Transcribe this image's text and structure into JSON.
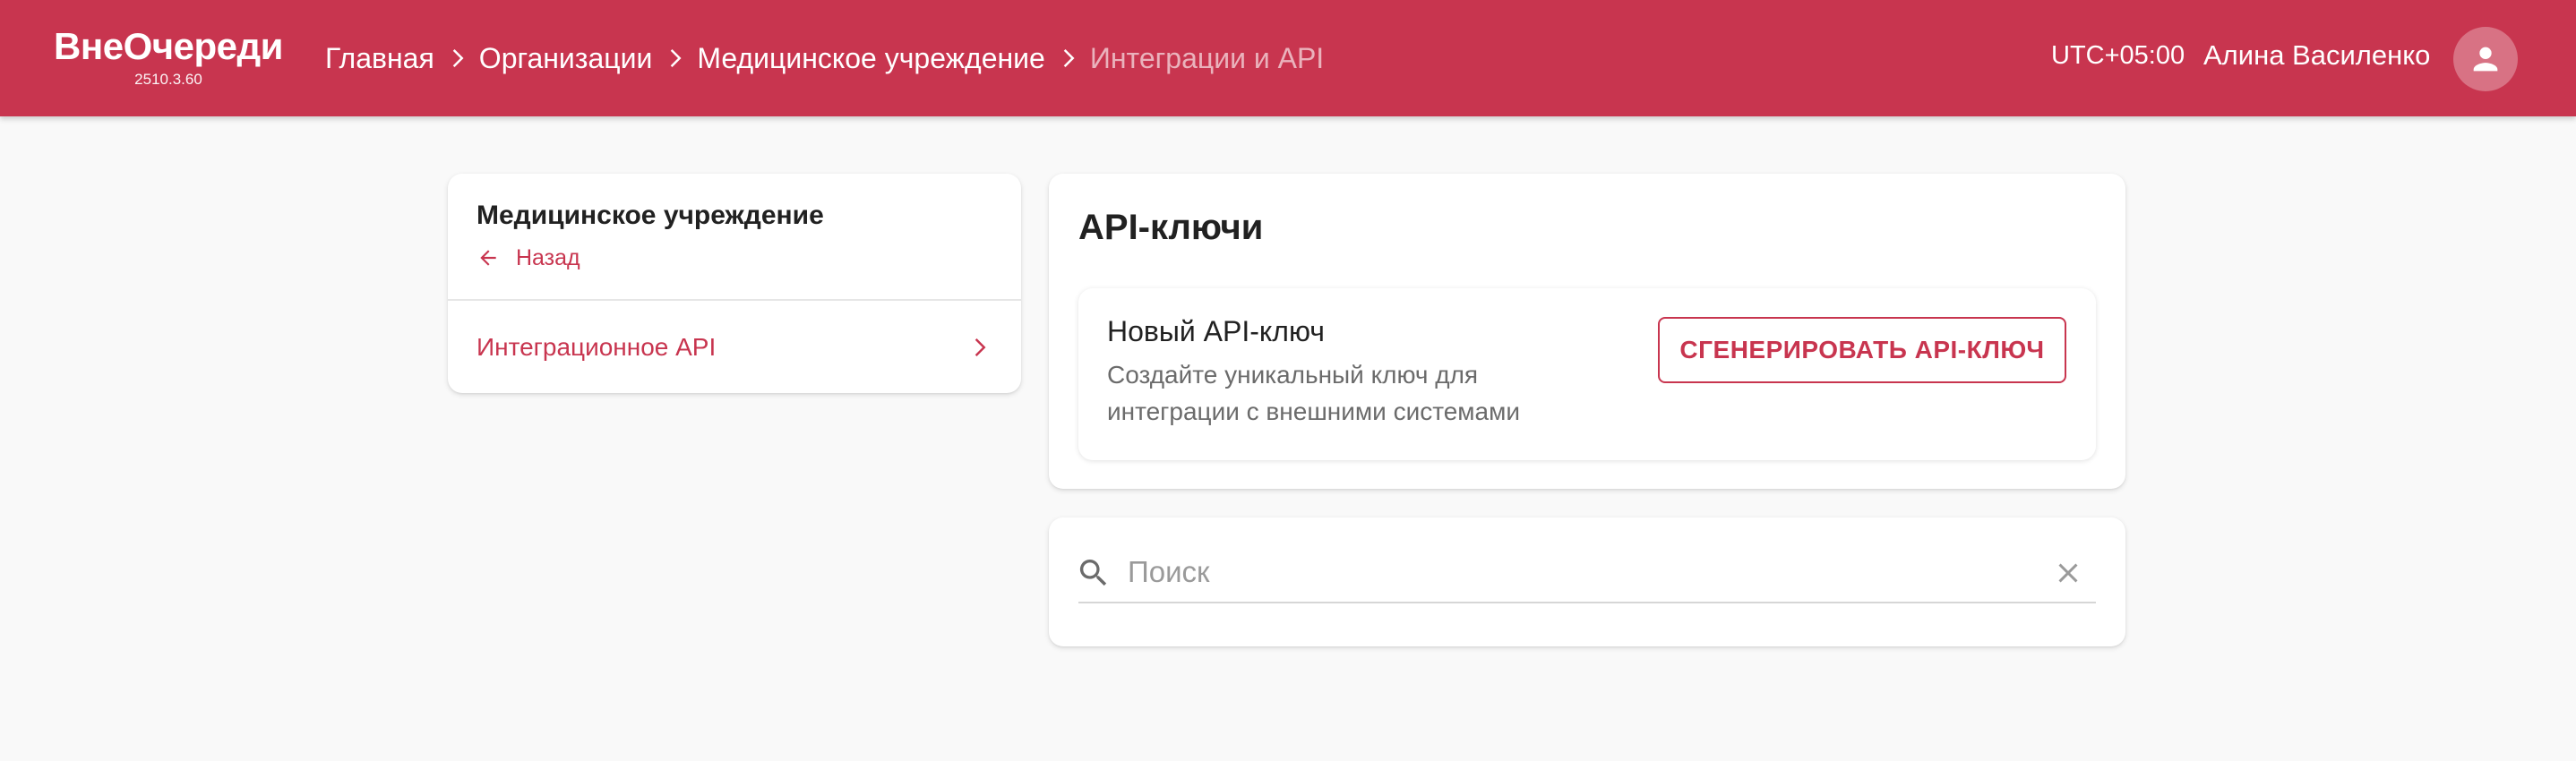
{
  "header": {
    "logo_title": "ВнеОчереди",
    "version": "2510.3.60",
    "breadcrumb": [
      {
        "label": "Главная"
      },
      {
        "label": "Организации"
      },
      {
        "label": "Медицинское учреждение"
      },
      {
        "label": "Интеграции и API"
      }
    ],
    "timezone": "UTC+05:00",
    "user_name": "Алина Василенко",
    "avatar_icon": "person-icon"
  },
  "sidebar": {
    "title": "Медицинское учреждение",
    "back_label": "Назад",
    "items": [
      {
        "label": "Интеграционное API",
        "icon": "chevron-right-icon"
      }
    ]
  },
  "main": {
    "title": "API-ключи",
    "new_key": {
      "title": "Новый API-ключ",
      "description": "Создайте уникальный ключ для интеграции с внешними системами",
      "button_label": "СГЕНЕРИРОВАТЬ API-КЛЮЧ"
    }
  },
  "search": {
    "placeholder": "Поиск",
    "value": ""
  },
  "colors": {
    "brand": "#c8354f",
    "background": "#f9f9f9"
  }
}
